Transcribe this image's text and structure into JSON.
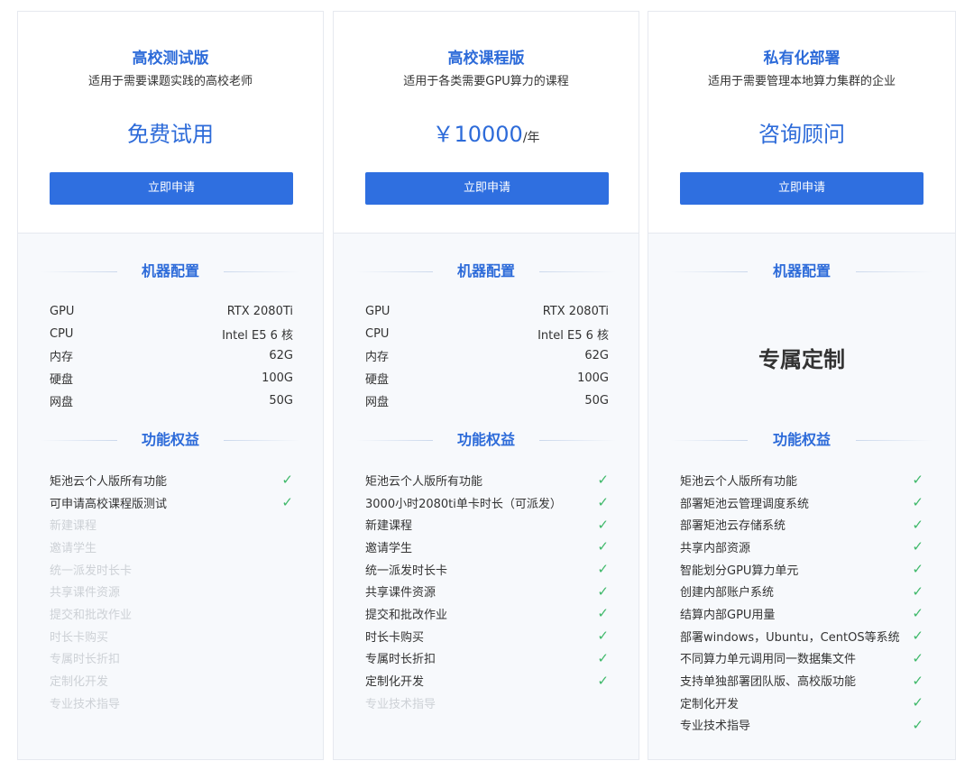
{
  "plans": [
    {
      "title": "高校测试版",
      "subtitle": "适用于需要课题实践的高校老师",
      "price_main": "免费试用",
      "price_unit": "",
      "button": "立即申请",
      "config_title": "机器配置",
      "specs": [
        {
          "label": "GPU",
          "value": "RTX 2080Ti"
        },
        {
          "label": "CPU",
          "value": "Intel E5 6 核"
        },
        {
          "label": "内存",
          "value": "62G"
        },
        {
          "label": "硬盘",
          "value": "100G"
        },
        {
          "label": "网盘",
          "value": "50G"
        }
      ],
      "features_title": "功能权益",
      "features": [
        {
          "text": "矩池云个人版所有功能",
          "included": true
        },
        {
          "text": "可申请高校课程版测试",
          "included": true
        },
        {
          "text": "新建课程",
          "included": false
        },
        {
          "text": "邀请学生",
          "included": false
        },
        {
          "text": "统一派发时长卡",
          "included": false
        },
        {
          "text": "共享课件资源",
          "included": false
        },
        {
          "text": "提交和批改作业",
          "included": false
        },
        {
          "text": "时长卡购买",
          "included": false
        },
        {
          "text": "专属时长折扣",
          "included": false
        },
        {
          "text": "定制化开发",
          "included": false
        },
        {
          "text": "专业技术指导",
          "included": false
        }
      ]
    },
    {
      "title": "高校课程版",
      "subtitle": "适用于各类需要GPU算力的课程",
      "price_main": "￥10000",
      "price_unit": "/年",
      "button": "立即申请",
      "config_title": "机器配置",
      "specs": [
        {
          "label": "GPU",
          "value": "RTX 2080Ti"
        },
        {
          "label": "CPU",
          "value": "Intel E5 6 核"
        },
        {
          "label": "内存",
          "value": "62G"
        },
        {
          "label": "硬盘",
          "value": "100G"
        },
        {
          "label": "网盘",
          "value": "50G"
        }
      ],
      "features_title": "功能权益",
      "features": [
        {
          "text": "矩池云个人版所有功能",
          "included": true
        },
        {
          "text": "3000小时2080ti单卡时长（可派发）",
          "included": true
        },
        {
          "text": "新建课程",
          "included": true
        },
        {
          "text": "邀请学生",
          "included": true
        },
        {
          "text": "统一派发时长卡",
          "included": true
        },
        {
          "text": "共享课件资源",
          "included": true
        },
        {
          "text": "提交和批改作业",
          "included": true
        },
        {
          "text": "时长卡购买",
          "included": true
        },
        {
          "text": "专属时长折扣",
          "included": true
        },
        {
          "text": "定制化开发",
          "included": true
        },
        {
          "text": "专业技术指导",
          "included": false
        }
      ]
    },
    {
      "title": "私有化部署",
      "subtitle": "适用于需要管理本地算力集群的企业",
      "price_main": "咨询顾问",
      "price_unit": "",
      "button": "立即申请",
      "config_title": "机器配置",
      "custom_text": "专属定制",
      "features_title": "功能权益",
      "features": [
        {
          "text": "矩池云个人版所有功能",
          "included": true
        },
        {
          "text": "部署矩池云管理调度系统",
          "included": true
        },
        {
          "text": "部署矩池云存储系统",
          "included": true
        },
        {
          "text": "共享内部资源",
          "included": true
        },
        {
          "text": "智能划分GPU算力单元",
          "included": true
        },
        {
          "text": "创建内部账户系统",
          "included": true
        },
        {
          "text": "结算内部GPU用量",
          "included": true
        },
        {
          "text": "部署windows，Ubuntu，CentOS等系统",
          "included": true
        },
        {
          "text": "不同算力单元调用同一数据集文件",
          "included": true
        },
        {
          "text": "支持单独部署团队版、高校版功能",
          "included": true
        },
        {
          "text": "定制化开发",
          "included": true
        },
        {
          "text": "专业技术指导",
          "included": true
        }
      ]
    }
  ],
  "check_icon": "✓",
  "colors": {
    "accent": "#2d6bd9",
    "button": "#2f6fe0",
    "check": "#3fb96a",
    "disabled": "#cdd1d6"
  }
}
